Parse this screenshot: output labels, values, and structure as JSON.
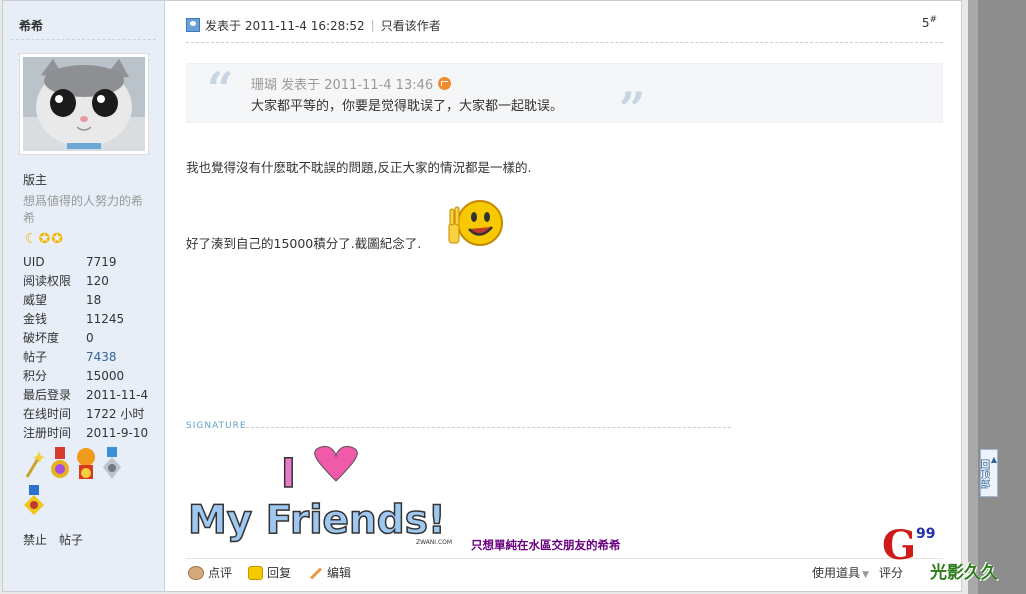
{
  "author": {
    "name": "希希",
    "group": "版主",
    "motto": "想爲値得的人努力的希希",
    "stats": [
      {
        "label": "UID",
        "value": "7719"
      },
      {
        "label": "阅读权限",
        "value": "120"
      },
      {
        "label": "威望",
        "value": "18"
      },
      {
        "label": "金钱",
        "value": "11245"
      },
      {
        "label": "破坏度",
        "value": "0"
      },
      {
        "label": "帖子",
        "value": "7438"
      },
      {
        "label": "积分",
        "value": "15000"
      },
      {
        "label": "最后登录",
        "value": "2011-11-4"
      },
      {
        "label": "在线时间",
        "value": "1722 小时"
      },
      {
        "label": "注册时间",
        "value": "2011-9-10"
      }
    ],
    "actions": [
      "禁止",
      "帖子"
    ]
  },
  "post": {
    "posted_at": "发表于 2011-11-4 16:28:52",
    "only_author": "只看该作者",
    "floor": "5",
    "floor_mark": "#",
    "quote": {
      "author_line": "珊瑚 发表于 2011-11-4 13:46",
      "text": "大家都平等的，你要是觉得耽误了，大家都一起耽误。"
    },
    "message_1": "我也覺得沒有什麽耽不耽誤的問題,反正大家的情況都是一樣的.",
    "message_2": "好了湊到自己的15000積分了.截圖紀念了.",
    "signature_label": "SIGNATURE",
    "signature_text": "只想單純在水區交朋友的希希",
    "signature_image_text": [
      "I",
      "My Friends!"
    ],
    "signature_credit": "ZWANI.COM"
  },
  "post_actions": [
    {
      "label": "点评",
      "icon": "comment-icon"
    },
    {
      "label": "回复",
      "icon": "reply-icon"
    },
    {
      "label": "编辑",
      "icon": "edit-icon"
    }
  ],
  "tools": {
    "use_item": "使用道具",
    "rate": "评分"
  },
  "back_to_top": "回顶部",
  "watermark": {
    "g": "G",
    "num": "99",
    "text": "光影久久"
  }
}
